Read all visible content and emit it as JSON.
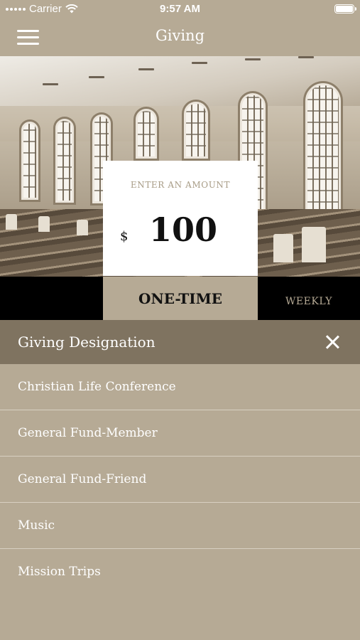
{
  "status_bar": {
    "carrier": "Carrier",
    "time": "9:57 AM",
    "battery_level": 1.0
  },
  "nav": {
    "title": "Giving",
    "menu_icon": "hamburger-menu-icon"
  },
  "amount": {
    "label": "ENTER AN AMOUNT",
    "currency": "$",
    "value": "100"
  },
  "frequency_tabs": [
    {
      "label": "",
      "selected": false
    },
    {
      "label": "ONE-TIME",
      "selected": true
    },
    {
      "label": "WEEKLY",
      "selected": false
    }
  ],
  "designation": {
    "title": "Giving Designation",
    "close_icon": "close-icon",
    "items": [
      {
        "label": "Christian Life Conference"
      },
      {
        "label": "General Fund-Member"
      },
      {
        "label": "General Fund-Friend"
      },
      {
        "label": "Music"
      },
      {
        "label": "Mission Trips"
      }
    ]
  },
  "colors": {
    "background": "#b6aa95",
    "header": "#7f7360",
    "tab_bar": "#000000",
    "card": "#ffffff"
  }
}
